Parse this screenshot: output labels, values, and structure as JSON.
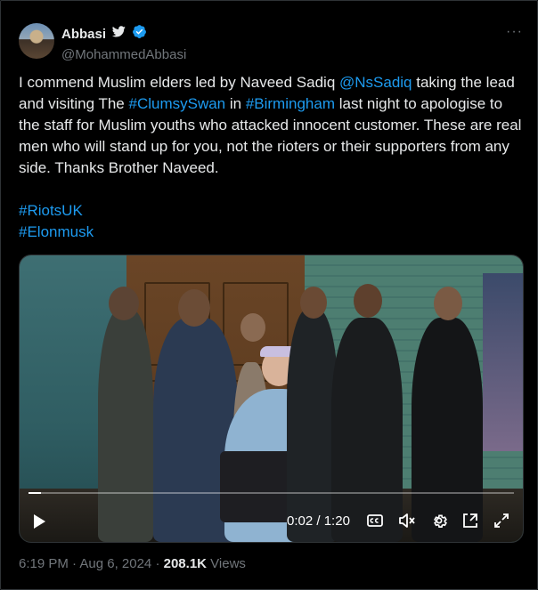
{
  "tweet": {
    "author": {
      "display_name": "Abbasi",
      "handle": "@MohammedAbbasi"
    },
    "text_parts": [
      "I commend Muslim elders led by Naveed Sadiq ",
      "@NsSadiq",
      " taking the lead and visiting The ",
      "#ClumsySwan",
      " in ",
      "#Birmingham",
      " last night to apologise to the staff for Muslim youths who attacked innocent customer. These are real men who will stand up for you, not the rioters or their supporters from any side. Thanks Brother Naveed."
    ],
    "hashtags": [
      "#RiotsUK",
      "#Elonmusk"
    ],
    "video": {
      "current_time": "0:02",
      "separator": "/",
      "duration": "1:20",
      "progress": 0.025
    },
    "timestamp": "6:19 PM · Aug 6, 2024",
    "views_separator": " · ",
    "views_count": "208.1K",
    "views_label": "Views"
  },
  "colors": {
    "background": "#000000",
    "text": "#e7e9ea",
    "secondary": "#71767b",
    "link": "#1d9bf0",
    "verified": "#1d9bf0"
  },
  "icons": {
    "bird": "twitter-bird-icon",
    "verified": "verified-badge-icon",
    "more": "more-horizontal-icon",
    "play": "play-icon",
    "captions": "closed-captions-icon",
    "volume": "volume-muted-icon",
    "settings": "settings-icon",
    "pip": "picture-in-picture-icon",
    "fullscreen": "fullscreen-icon"
  }
}
